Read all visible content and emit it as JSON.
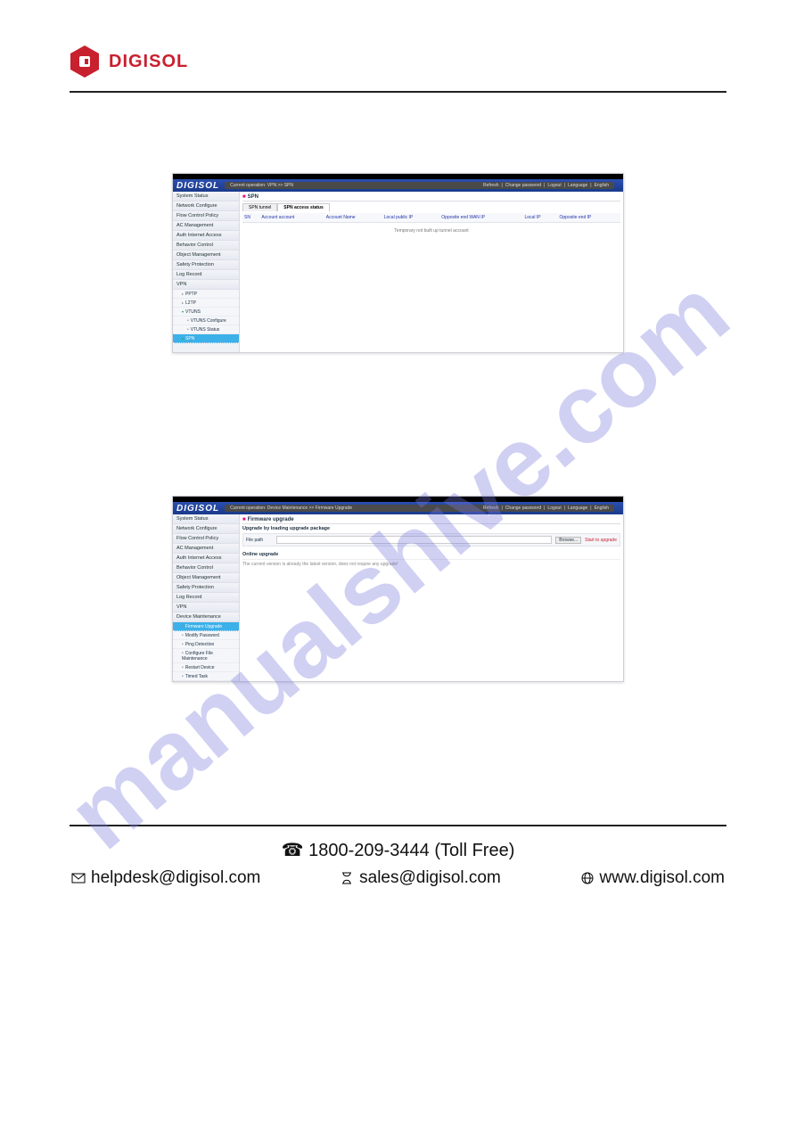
{
  "brand": {
    "name": "DIGISOL"
  },
  "watermark": "manualshive.com",
  "screenshot1": {
    "brand": "DIGISOL",
    "breadcrumb": "Current operation: VPN >> SPN",
    "toplinks": [
      "Refresh",
      "Change password",
      "Logout",
      "Language",
      "English"
    ],
    "sidebar": [
      {
        "label": "System Status"
      },
      {
        "label": "Network Configure"
      },
      {
        "label": "Flow Control Policy"
      },
      {
        "label": "AC Management"
      },
      {
        "label": "Auth Internet Access"
      },
      {
        "label": "Behavior Control"
      },
      {
        "label": "Object Management"
      },
      {
        "label": "Safety Protection"
      },
      {
        "label": "Log Record"
      },
      {
        "label": "VPN"
      }
    ],
    "vpn_sub": [
      {
        "label": "PPTP",
        "expanded": false
      },
      {
        "label": "L2TP",
        "expanded": false
      },
      {
        "label": "VTUNS",
        "expanded": true,
        "children": [
          {
            "label": "VTUNS Configure"
          },
          {
            "label": "VTUNS Status"
          }
        ]
      },
      {
        "label": "SPN",
        "selected": true
      }
    ],
    "panel_title": "SPN",
    "tabs": [
      "SPN tunnel",
      "SPN access status"
    ],
    "table_headers": [
      "SN",
      "Account account",
      "Account Name",
      "Local public IP",
      "Opposite end WAN IP",
      "Local IP",
      "Opposite end IP"
    ],
    "empty_msg": "Temporary not built up tunnel account"
  },
  "screenshot2": {
    "brand": "DIGISOL",
    "breadcrumb": "Current operation: Device Maintenance >> Firmware Upgrade",
    "toplinks": [
      "Refresh",
      "Change password",
      "Logout",
      "Language",
      "English"
    ],
    "sidebar": [
      {
        "label": "System Status"
      },
      {
        "label": "Network Configure"
      },
      {
        "label": "Flow Control Policy"
      },
      {
        "label": "AC Management"
      },
      {
        "label": "Auth Internet Access"
      },
      {
        "label": "Behavior Control"
      },
      {
        "label": "Object Management"
      },
      {
        "label": "Safety Protection"
      },
      {
        "label": "Log Record"
      },
      {
        "label": "VPN"
      },
      {
        "label": "Device Maintenance"
      }
    ],
    "maint_sub": [
      {
        "label": "Firmware Upgrade",
        "selected": true
      },
      {
        "label": "Modify Password"
      },
      {
        "label": "Ping Detection"
      },
      {
        "label": "Configure File Maintenance"
      },
      {
        "label": "Restart Device"
      },
      {
        "label": "Timed Task"
      }
    ],
    "panel_title": "Firmware upgrade",
    "section1_title": "Upgrade by loading upgrade package",
    "file_label": "File path",
    "browse_label": "Browse...",
    "start_label": "Start to upgrade",
    "section2_title": "Online upgrade",
    "online_note": "The current version is already the latest version, does not require any upgrade!"
  },
  "footer": {
    "phone_label": "1800-209-3444 (Toll Free)",
    "helpdesk": "helpdesk@digisol.com",
    "sales": "sales@digisol.com",
    "web": "www.digisol.com"
  }
}
